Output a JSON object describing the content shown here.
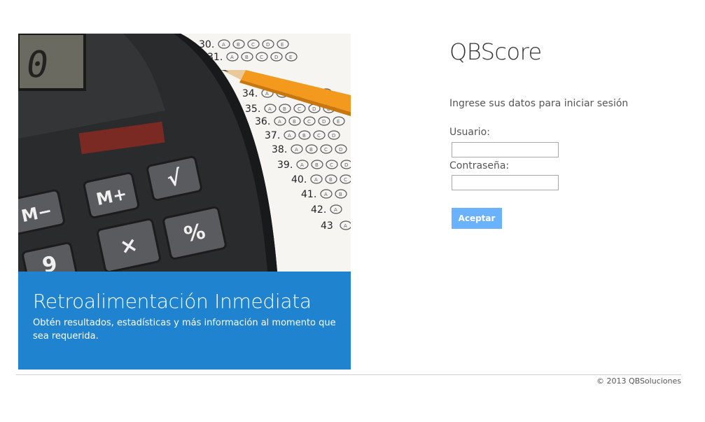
{
  "login": {
    "app_title": "QBScore",
    "prompt": "Ingrese sus datos para iniciar sesión",
    "username_label": "Usuario:",
    "username_value": "",
    "password_label": "Contraseña:",
    "password_value": "",
    "submit_label": "Aceptar"
  },
  "hero": {
    "title": "Retroalimentación Inmediata",
    "description": "Obtén resultados, estadísticas y más información al momento que sea requerida.",
    "calculator_keys": [
      "M−",
      "M+",
      "√",
      "×",
      "%",
      "9"
    ],
    "answer_sheet_numbers": [
      "30.",
      "31.",
      "34.",
      "35.",
      "36.",
      "37.",
      "38.",
      "39.",
      "40.",
      "41.",
      "42.",
      "43"
    ],
    "bubble_letters": [
      "A",
      "B",
      "C",
      "D",
      "E"
    ],
    "display_digit": "0"
  },
  "footer": {
    "copyright": "© 2013 QBSoluciones"
  },
  "colors": {
    "banner": "#1f83cf",
    "button": "#68b2ff",
    "pencil": "#f39a1e"
  }
}
